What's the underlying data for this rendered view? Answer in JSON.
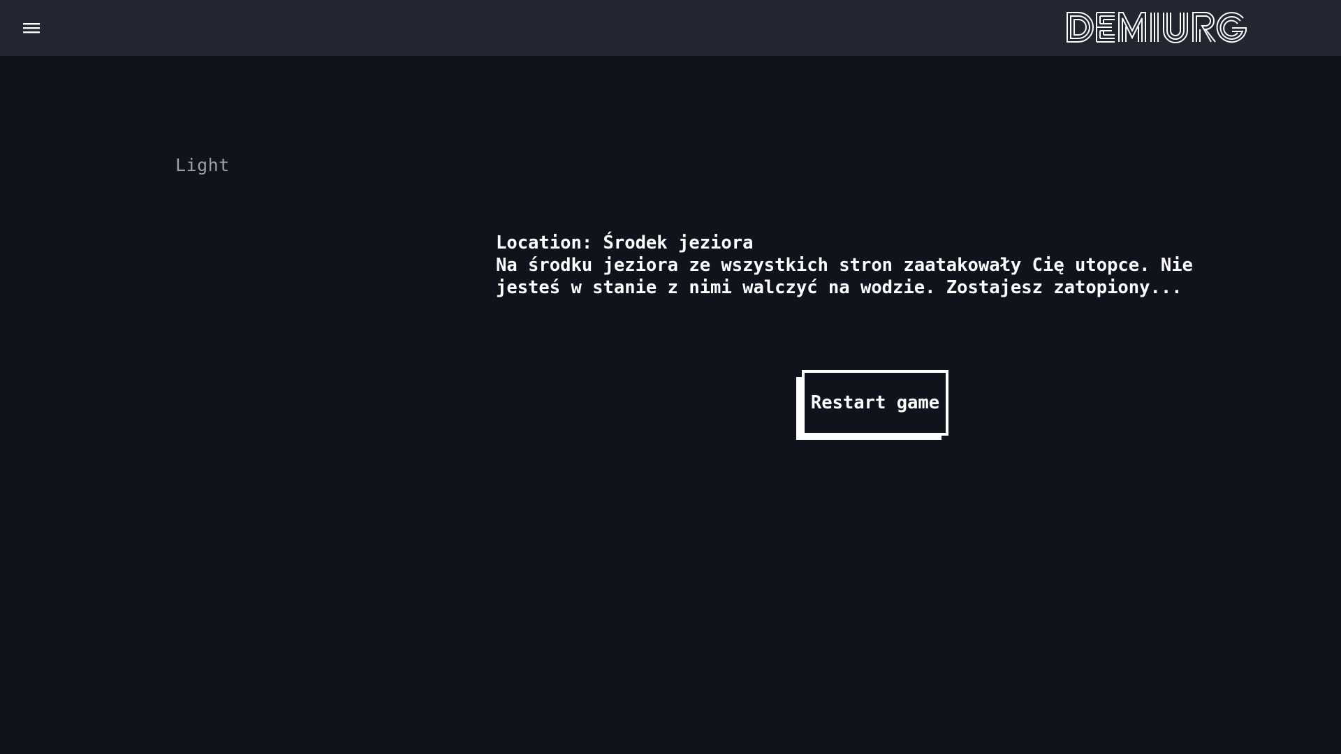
{
  "header": {
    "menu_icon": "hamburger-menu-icon",
    "logo_text": "DEMIURG",
    "background": "#212631"
  },
  "theme_toggle": {
    "label": "Light"
  },
  "story": {
    "location_line": "Location: Środek jeziora",
    "description_lines": [
      "Na środku jeziora ze wszystkich stron zaatakowały Cię utopce. Nie",
      "jesteś w stanie z nimi walczyć na wodzie. Zostajesz zatopiony..."
    ]
  },
  "actions": {
    "restart_label": "Restart game"
  },
  "colors": {
    "page_background": "#10131b",
    "text": "#ffffff",
    "muted_text": "#9aa0aa"
  }
}
